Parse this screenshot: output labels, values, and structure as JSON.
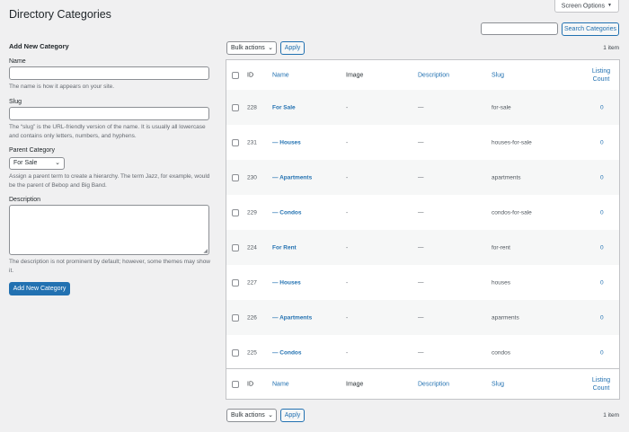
{
  "page": {
    "title": "Directory Categories",
    "screen_options": "Screen Options",
    "search_button": "Search Categories"
  },
  "form": {
    "title": "Add New Category",
    "name_label": "Name",
    "name_value": "",
    "name_help": "The name is how it appears on your site.",
    "slug_label": "Slug",
    "slug_value": "",
    "slug_help": "The “slug” is the URL-friendly version of the name. It is usually all lowercase and contains only letters, numbers, and hyphens.",
    "parent_label": "Parent Category",
    "parent_selected": "For Sale",
    "parent_help": "Assign a parent term to create a hierarchy. The term Jazz, for example, would be the parent of Bebop and Big Band.",
    "description_label": "Description",
    "description_value": "",
    "description_help": "The description is not prominent by default; however, some themes may show it.",
    "submit_label": "Add New Category"
  },
  "list": {
    "bulk_actions": "Bulk actions",
    "apply": "Apply",
    "count": "1 item",
    "columns": {
      "id": "ID",
      "name": "Name",
      "image": "Image",
      "description": "Description",
      "slug": "Slug",
      "listing_count": "Listing Count"
    },
    "rows": [
      {
        "id": "228",
        "name": "For Sale",
        "image": "-",
        "description": "—",
        "slug": "for-sale",
        "count": "0"
      },
      {
        "id": "231",
        "name": "— Houses",
        "image": "-",
        "description": "—",
        "slug": "houses-for-sale",
        "count": "0"
      },
      {
        "id": "230",
        "name": "— Apartments",
        "image": "-",
        "description": "—",
        "slug": "apartments",
        "count": "0"
      },
      {
        "id": "229",
        "name": "— Condos",
        "image": "-",
        "description": "—",
        "slug": "condos-for-sale",
        "count": "0"
      },
      {
        "id": "224",
        "name": "For Rent",
        "image": "-",
        "description": "—",
        "slug": "for-rent",
        "count": "0"
      },
      {
        "id": "227",
        "name": "— Houses",
        "image": "-",
        "description": "—",
        "slug": "houses",
        "count": "0"
      },
      {
        "id": "226",
        "name": "— Apartments",
        "image": "-",
        "description": "—",
        "slug": "aparments",
        "count": "0"
      },
      {
        "id": "225",
        "name": "— Condos",
        "image": "-",
        "description": "—",
        "slug": "condos",
        "count": "0"
      }
    ]
  }
}
